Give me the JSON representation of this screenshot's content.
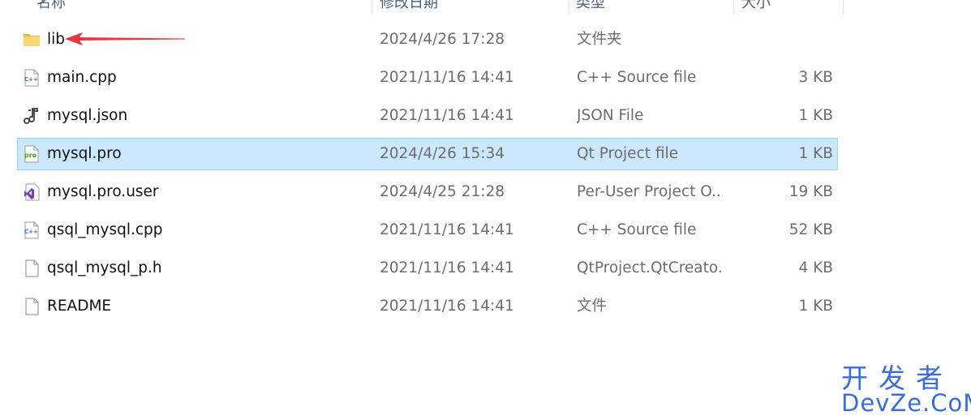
{
  "columns": {
    "name": "名称",
    "date": "修改日期",
    "type": "类型",
    "size": "大小"
  },
  "files": [
    {
      "name": "lib",
      "date": "2024/4/26 17:28",
      "type": "文件夹",
      "size": "",
      "icon": "folder-icon"
    },
    {
      "name": "main.cpp",
      "date": "2021/11/16 14:41",
      "type": "C++ Source file",
      "size": "3 KB",
      "icon": "cpp-file-icon"
    },
    {
      "name": "mysql.json",
      "date": "2021/11/16 14:41",
      "type": "JSON File",
      "size": "1 KB",
      "icon": "json-file-icon"
    },
    {
      "name": "mysql.pro",
      "date": "2024/4/26 15:34",
      "type": "Qt Project file",
      "size": "1 KB",
      "icon": "pro-file-icon",
      "selected": true
    },
    {
      "name": "mysql.pro.user",
      "date": "2024/4/25 21:28",
      "type": "Per-User Project O...",
      "size": "19 KB",
      "icon": "visual-studio-file-icon"
    },
    {
      "name": "qsql_mysql.cpp",
      "date": "2021/11/16 14:41",
      "type": "C++ Source file",
      "size": "52 KB",
      "icon": "cpp-file-icon"
    },
    {
      "name": "qsql_mysql_p.h",
      "date": "2021/11/16 14:41",
      "type": "QtProject.QtCreato...",
      "size": "4 KB",
      "icon": "blank-file-icon"
    },
    {
      "name": "README",
      "date": "2021/11/16 14:41",
      "type": "文件",
      "size": "1 KB",
      "icon": "blank-file-icon"
    }
  ],
  "watermark": {
    "cn": "开发者",
    "en": "DevZe.CoM"
  },
  "colors": {
    "selection_bg": "#cce8ff",
    "selection_border": "#99d1ff",
    "annotation_arrow": "#e8383d",
    "watermark": "#3a6dd8"
  }
}
